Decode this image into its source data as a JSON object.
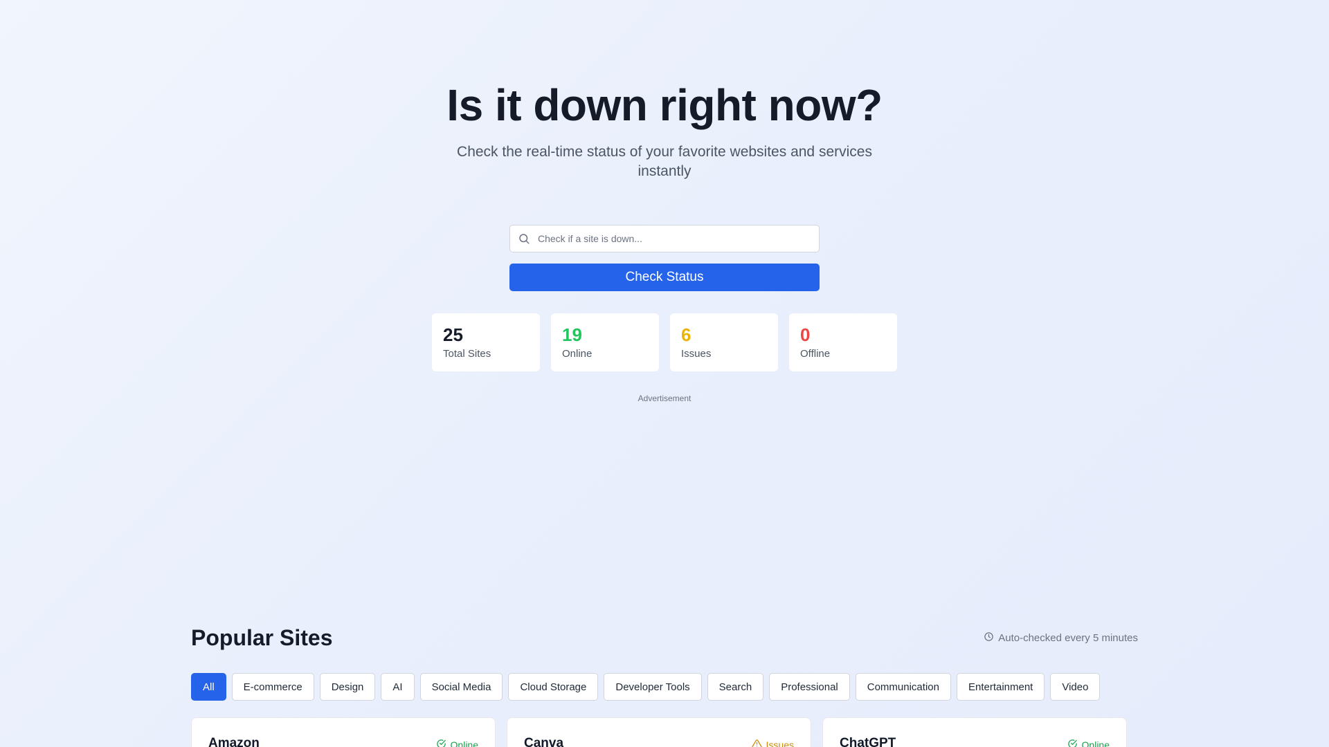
{
  "hero": {
    "title": "Is it down right now?",
    "subtitle": "Check the real-time status of your favorite websites and services instantly"
  },
  "search": {
    "placeholder": "Check if a site is down...",
    "button_label": "Check Status"
  },
  "stats": [
    {
      "value": "25",
      "label": "Total Sites",
      "color": "#151b28"
    },
    {
      "value": "19",
      "label": "Online",
      "color": "#22c55e"
    },
    {
      "value": "6",
      "label": "Issues",
      "color": "#eab308"
    },
    {
      "value": "0",
      "label": "Offline",
      "color": "#ef4444"
    }
  ],
  "ad_label": "Advertisement",
  "popular": {
    "title": "Popular Sites",
    "auto_check": "Auto-checked every 5 minutes",
    "filters": [
      "All",
      "E-commerce",
      "Design",
      "AI",
      "Social Media",
      "Cloud Storage",
      "Developer Tools",
      "Search",
      "Professional",
      "Communication",
      "Entertainment",
      "Video"
    ],
    "active_filter": "All"
  },
  "sites": [
    {
      "name": "Amazon",
      "status": "Online",
      "status_color": "#16a34a",
      "icon": "check-circle-icon"
    },
    {
      "name": "Canva",
      "status": "Issues",
      "status_color": "#ca8a04",
      "icon": "warning-icon"
    },
    {
      "name": "ChatGPT",
      "status": "Online",
      "status_color": "#16a34a",
      "icon": "check-circle-icon"
    }
  ],
  "colors": {
    "accent": "#2563eb"
  }
}
